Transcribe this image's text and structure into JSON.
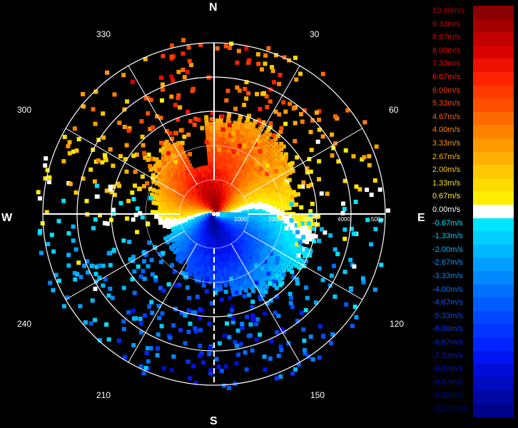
{
  "cardinal": {
    "n": "N",
    "s": "S",
    "e": "E",
    "w": "W"
  },
  "azimuth_labels": [
    "30",
    "60",
    "120",
    "150",
    "210",
    "240",
    "300",
    "330"
  ],
  "range_labels": [
    "1000",
    "2000",
    "3000",
    "4000",
    "500u"
  ],
  "colorbar": {
    "labels": [
      "10.00m/s",
      "9.33m/s",
      "8.67m/s",
      "8.00m/s",
      "7.33m/s",
      "6.67m/s",
      "6.00m/s",
      "5.33m/s",
      "4.67m/s",
      "4.00m/s",
      "3.33m/s",
      "2.67m/s",
      "2.00m/s",
      "1.33m/s",
      "0.67m/s",
      "0.00m/s",
      "-0.67m/s",
      "-1.33m/s",
      "-2.00m/s",
      "-2.67m/s",
      "-3.33m/s",
      "-4.00m/s",
      "-4.67m/s",
      "-5.33m/s",
      "-6.00m/s",
      "-6.67m/s",
      "-7.33m/s",
      "-8.00m/s",
      "-8.67m/s",
      "-9.33m/s",
      "-10.00m/s"
    ],
    "colors": [
      "#8b0000",
      "#a50000",
      "#c00000",
      "#d80000",
      "#ee1100",
      "#ff2200",
      "#ff3b00",
      "#ff5000",
      "#ff6a00",
      "#ff8200",
      "#ff9a00",
      "#ffb000",
      "#ffc800",
      "#ffdc00",
      "#ffee00",
      "#ffffff",
      "#00e5ff",
      "#00cfff",
      "#00b8ff",
      "#009fff",
      "#0088ff",
      "#0070ff",
      "#005cff",
      "#0048ff",
      "#0036ff",
      "#0024ff",
      "#0014f0",
      "#000ed8",
      "#000abe",
      "#0006a4",
      "#00038a"
    ],
    "label_colors": [
      "#b00000",
      "#c80000",
      "#d80000",
      "#e60000",
      "#f20000",
      "#ff1a00",
      "#ff3000",
      "#ff4a00",
      "#ff6400",
      "#ff8000",
      "#ff9c00",
      "#ffb400",
      "#ffcc00",
      "#ffe000",
      "#ffee44",
      "#ffffff",
      "#00e5ff",
      "#00cfff",
      "#00b8ff",
      "#009fff",
      "#0088ff",
      "#0070ff",
      "#005cff",
      "#0048ff",
      "#0036ff",
      "#0024ff",
      "#0018e0",
      "#0012c8",
      "#000eb0",
      "#000a98",
      "#000680"
    ]
  }
}
